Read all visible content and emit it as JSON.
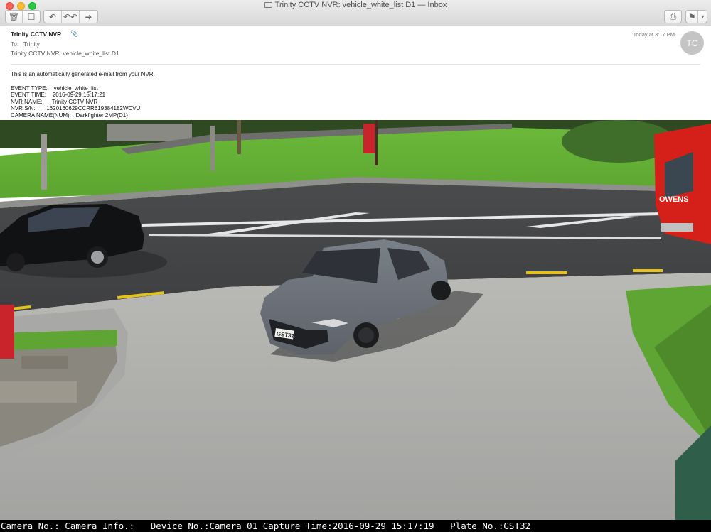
{
  "window": {
    "title": "Trinity CCTV NVR: vehicle_white_list D1 — Inbox"
  },
  "toolbar": {
    "icons": [
      "trash-icon",
      "junk-icon",
      "reply-icon",
      "reply-all-icon",
      "forward-icon",
      "print-icon",
      "flag-icon",
      "chevron-down-icon"
    ],
    "flag_color": "#e0201b"
  },
  "message": {
    "from": "Trinity CCTV NVR",
    "to_label": "To:",
    "to": "Trinity",
    "subject": "Trinity CCTV NVR: vehicle_white_list D1",
    "datetime": "Today at 3:17 PM",
    "avatar_initials": "TC"
  },
  "body": {
    "intro": "This is an automatically generated e-mail from your NVR.",
    "fields": [
      "EVENT TYPE:    vehicle_white_list",
      "EVENT TIME:    2016-09-29,15:17:21",
      "NVR NAME:      Trinity CCTV NVR",
      "NVR S/N:       1620160629CCRR619384182WCVU",
      "CAMERA NAME(NUM):   Darkfighter 2MP(D1)"
    ]
  },
  "camera": {
    "sign_text": "",
    "truck_text": "OWENS",
    "plate": "GST32",
    "overlay": "Camera No.: Camera Info.:   Device No.:Camera 01 Capture Time:2016-09-29 15:17:19   Plate No.:GST32"
  }
}
